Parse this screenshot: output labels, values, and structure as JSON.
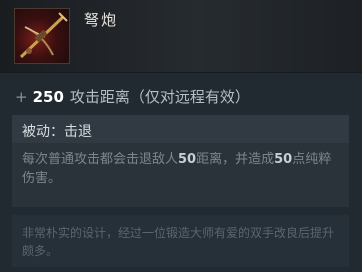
{
  "item": {
    "name": "弩炮",
    "icon": "ballista-icon"
  },
  "attribute": {
    "prefix": "+",
    "value": "250",
    "label": "攻击距离（仅对远程有效）"
  },
  "ability": {
    "title": "被动：击退",
    "desc_part1": "每次普通攻击都会击退敌人",
    "distance": "50",
    "desc_part2": "距离，并造成",
    "damage": "50",
    "desc_part3": "点纯粹伤害。"
  },
  "lore": {
    "text": "非常朴实的设计，经过一位锻造大师有爱的双手改良后提升颇多。"
  },
  "colors": {
    "background": "#222a31",
    "highlight": "#ffffff",
    "muted": "#7d858d"
  }
}
